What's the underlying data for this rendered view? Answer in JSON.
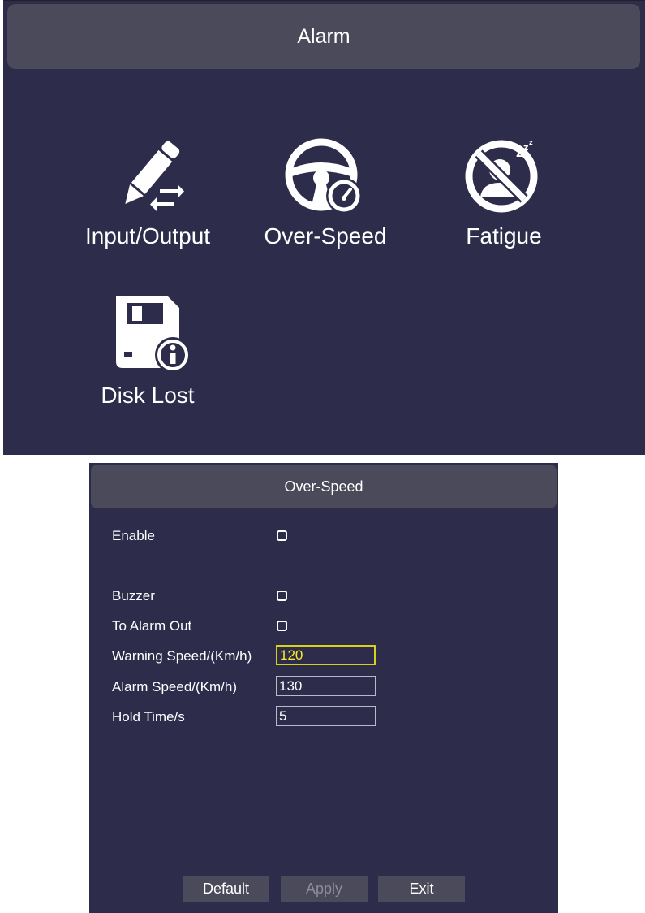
{
  "alarm_menu": {
    "title": "Alarm",
    "items": [
      {
        "label": "Input/Output",
        "icon": "pencil-arrows-icon"
      },
      {
        "label": "Over-Speed",
        "icon": "steering-wheel-speedometer-icon"
      },
      {
        "label": "Fatigue",
        "icon": "no-sleep-icon"
      },
      {
        "label": "Disk Lost",
        "icon": "disk-info-icon"
      }
    ]
  },
  "over_speed_dialog": {
    "title": "Over-Speed",
    "enable": {
      "label": "Enable",
      "checked": false
    },
    "buzzer": {
      "label": "Buzzer",
      "checked": false
    },
    "to_alarm_out": {
      "label": "To Alarm Out",
      "checked": false
    },
    "warning_speed": {
      "label": "Warning Speed/(Km/h)",
      "value": "120"
    },
    "alarm_speed": {
      "label": "Alarm Speed/(Km/h)",
      "value": "130"
    },
    "hold_time": {
      "label": "Hold Time/s",
      "value": "5"
    },
    "buttons": {
      "default": "Default",
      "apply": "Apply",
      "exit": "Exit"
    }
  },
  "colors": {
    "panel_bg": "#2d2c4b",
    "header_bg": "#4a4a5a",
    "text": "#ffffff",
    "focus_border": "#d8d01a",
    "focus_text": "#ffea2a"
  }
}
